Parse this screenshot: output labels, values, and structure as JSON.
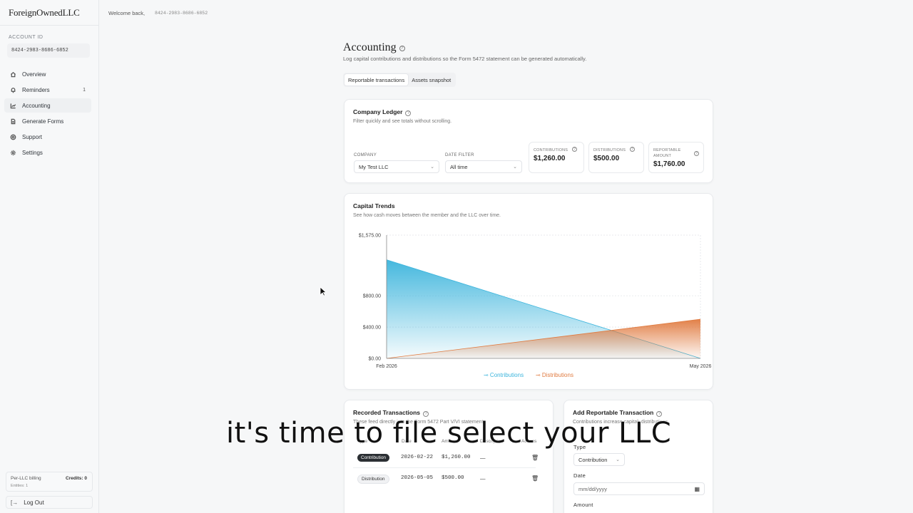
{
  "app": {
    "brand": "ForeignOwnedLLC"
  },
  "sidebar": {
    "account_label": "ACCOUNT ID",
    "account_id": "8424-2983-8686-6852",
    "items": [
      {
        "label": "Overview",
        "icon": "home-icon"
      },
      {
        "label": "Reminders",
        "icon": "bell-icon",
        "badge": "1"
      },
      {
        "label": "Accounting",
        "icon": "chart-icon"
      },
      {
        "label": "Generate Forms",
        "icon": "file-icon"
      },
      {
        "label": "Support",
        "icon": "help-circle-icon"
      },
      {
        "label": "Settings",
        "icon": "gear-icon"
      }
    ],
    "billing": {
      "title": "Per-LLC billing",
      "credits": "Credits: 0",
      "entities": "Entities: 1"
    },
    "logout": "Log Out"
  },
  "topbar": {
    "welcome": "Welcome back,",
    "account_id": "8424-2983-8686-6852"
  },
  "page": {
    "title": "Accounting",
    "subtitle": "Log capital contributions and distributions so the Form 5472 statement can be generated automatically.",
    "tabs": [
      "Reportable transactions",
      "Assets snapshot"
    ]
  },
  "ledger": {
    "title": "Company Ledger",
    "subtitle": "Filter quickly and see totals without scrolling.",
    "company_label": "COMPANY",
    "company_value": "My Test LLC",
    "date_label": "DATE FILTER",
    "date_value": "All time",
    "stats": {
      "contributions": {
        "label": "CONTRIBUTIONS",
        "value": "$1,260.00"
      },
      "distributions": {
        "label": "DISTRIBUTIONS",
        "value": "$500.00"
      },
      "reportable": {
        "label": "REPORTABLE AMOUNT",
        "value": "$1,760.00"
      }
    }
  },
  "trends": {
    "title": "Capital Trends",
    "subtitle": "See how cash moves between the member and the LLC over time."
  },
  "chart_data": {
    "type": "area",
    "x": [
      "Feb 2026",
      "May 2026"
    ],
    "y_ticks": [
      "$0.00",
      "$400.00",
      "$800.00",
      "$1,575.00"
    ],
    "ylim": [
      0,
      1575
    ],
    "series": [
      {
        "name": "Contributions",
        "values": [
          1260,
          0
        ],
        "color": "#3bb4dc"
      },
      {
        "name": "Distributions",
        "values": [
          0,
          500
        ],
        "color": "#e07a3f"
      }
    ],
    "grid": true,
    "legend": "bottom"
  },
  "recorded": {
    "title": "Recorded Transactions",
    "subtitle": "These feed directly into the Form 5472 Part V/VI statement.",
    "columns": [
      "Type",
      "Date",
      "Amount",
      "Description",
      "Actions"
    ],
    "rows": [
      {
        "type": "Contribution",
        "date": "2026-02-22",
        "amount": "$1,260.00",
        "description": "—"
      },
      {
        "type": "Distribution",
        "date": "2026-05-05",
        "amount": "$500.00",
        "description": "—"
      }
    ]
  },
  "add_tx": {
    "title": "Add Reportable Transaction",
    "subtitle": "Contributions increase capital; distributions",
    "type_label": "Type",
    "type_value": "Contribution",
    "date_label": "Date",
    "date_placeholder": "mm/dd/yyyy",
    "amount_label": "Amount"
  },
  "caption": "it's time to file select your LLC"
}
